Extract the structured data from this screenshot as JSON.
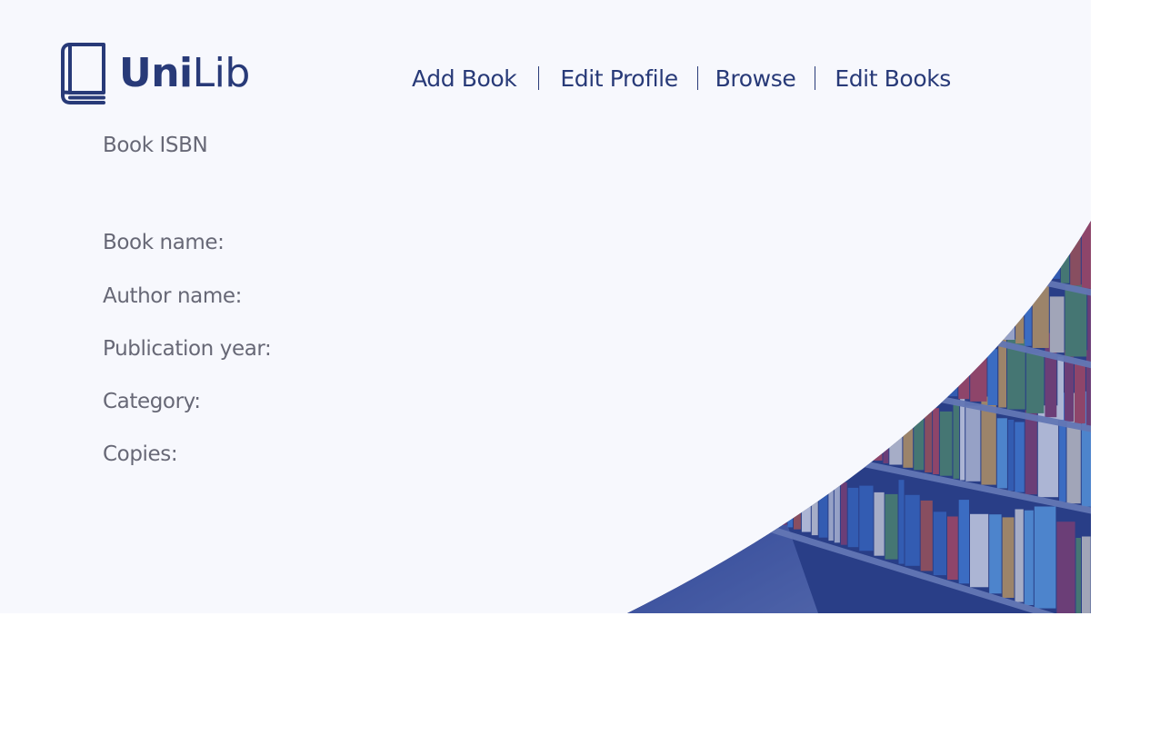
{
  "brand": {
    "name_bold": "Uni",
    "name_light": "Lib"
  },
  "nav": {
    "add_book": "Add Book",
    "edit_profile": "Edit Profile",
    "browse": "Browse",
    "edit_books": "Edit Books"
  },
  "form": {
    "isbn_label": "Book ISBN",
    "book_name_label": "Book name:",
    "author_name_label": "Author name:",
    "publication_year_label": "Publication year:",
    "category_label": "Category:",
    "copies_label": "Copies:"
  },
  "colors": {
    "brand": "#283a78",
    "panel_background": "#f7f8fd",
    "label_text": "#676876",
    "hero_overlay": "#3a56b8"
  },
  "icons": {
    "logo": "book-icon"
  }
}
